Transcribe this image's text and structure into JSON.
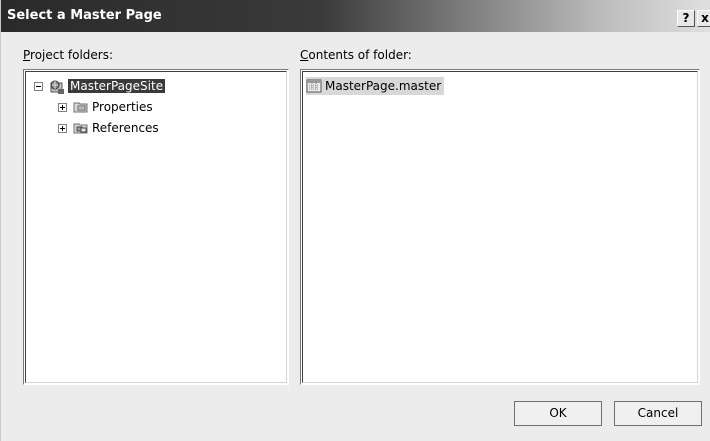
{
  "window": {
    "title": "Select a Master Page",
    "help_label": "?",
    "close_label": "x"
  },
  "left_panel": {
    "label_mnemonic": "P",
    "label_rest": "roject folders:",
    "tree": [
      {
        "label": "MasterPageSite",
        "expander": "minus",
        "icon": "project-icon",
        "selected": true
      },
      {
        "label": "Properties",
        "expander": "plus",
        "icon": "properties-folder-icon",
        "selected": false
      },
      {
        "label": "References",
        "expander": "plus",
        "icon": "references-folder-icon",
        "selected": false
      }
    ]
  },
  "right_panel": {
    "label_mnemonic": "C",
    "label_rest": "ontents of folder:",
    "files": [
      {
        "label": "MasterPage.master",
        "icon": "master-page-file-icon",
        "selected": true
      }
    ]
  },
  "buttons": {
    "ok": "OK",
    "cancel": "Cancel"
  }
}
